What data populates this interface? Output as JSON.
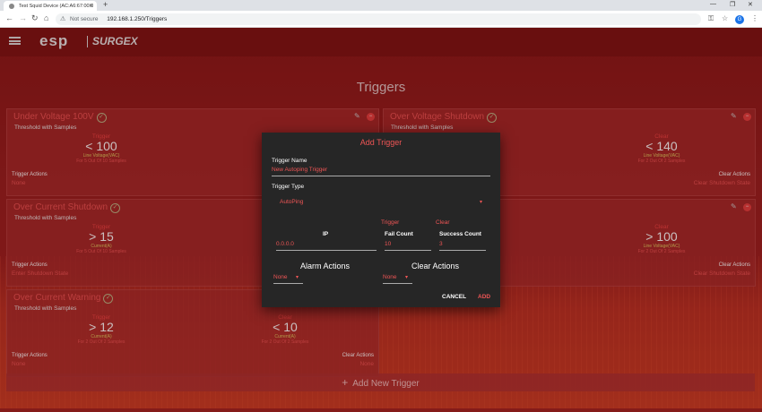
{
  "browser": {
    "tab_title": "Test Squid Device (AC:A6:67:00:0",
    "security_label": "Not secure",
    "url": "192.168.1.250/Triggers"
  },
  "app": {
    "logo_primary": "esp",
    "logo_secondary": "SURGEX",
    "page_title": "Triggers",
    "add_new_label": "Add New Trigger"
  },
  "cards": [
    {
      "title": "Under Voltage 100V",
      "subtitle": "Threshold with Samples",
      "trigger": {
        "label": "Trigger",
        "value": "< 100",
        "source": "Line Voltage(VAC)",
        "samples": "For 5 Out Of 10 Samples"
      },
      "actions_label": "Trigger Actions",
      "actions_value": "None"
    },
    {
      "title": "Over Voltage Shutdown",
      "subtitle": "Threshold with Samples",
      "clear": {
        "label": "Clear",
        "value": "< 140",
        "source": "Line Voltage(VAC)",
        "samples": "For 2 Out Of 2 Samples"
      },
      "clear_actions_label": "Clear Actions",
      "clear_actions_value": "Clear Shutdown State"
    },
    {
      "title": "Over Current Shutdown",
      "subtitle": "Threshold with Samples",
      "trigger": {
        "label": "Trigger",
        "value": "> 15",
        "source": "Current(A)",
        "samples": "For 5 Out Of 10 Samples"
      },
      "actions_label": "Trigger Actions",
      "actions_value": "Enter Shutdown State"
    },
    {
      "clear": {
        "label": "Clear",
        "value": "> 100",
        "source": "Line Voltage(VAC)",
        "samples": "For 2 Out Of 2 Samples"
      },
      "clear_actions_label": "Clear Actions",
      "clear_actions_value": "Clear Shutdown State"
    },
    {
      "title": "Over Current Warning",
      "subtitle": "Threshold with Samples",
      "trigger": {
        "label": "Trigger",
        "value": "> 12",
        "source": "Current(A)",
        "samples": "For 2 Out Of 2 Samples"
      },
      "clear": {
        "label": "Clear",
        "value": "< 10",
        "source": "Current(A)",
        "samples": "For 2 Out Of 2 Samples"
      },
      "actions_label": "Trigger Actions",
      "actions_value": "None",
      "clear_actions_label": "Clear Actions",
      "clear_actions_value": "None"
    }
  ],
  "dialog": {
    "title": "Add Trigger",
    "name_label": "Trigger Name",
    "name_value": "New Autoping Trigger",
    "type_label": "Trigger Type",
    "type_value": "AutoPing",
    "trigger_head": "Trigger",
    "clear_head": "Clear",
    "ip_label": "IP",
    "ip_value": "0.0.0.0",
    "fail_label": "Fail Count",
    "fail_value": "10",
    "success_label": "Success Count",
    "success_value": "3",
    "alarm_actions_label": "Alarm Actions",
    "alarm_actions_value": "None",
    "clear_actions_label": "Clear Actions",
    "clear_actions_value": "None",
    "cancel_label": "CANCEL",
    "add_label": "ADD"
  },
  "colors": {
    "accent": "#e55555",
    "background": "#8e1a1a",
    "dialog": "#262626",
    "caution": "#e0cc60"
  }
}
